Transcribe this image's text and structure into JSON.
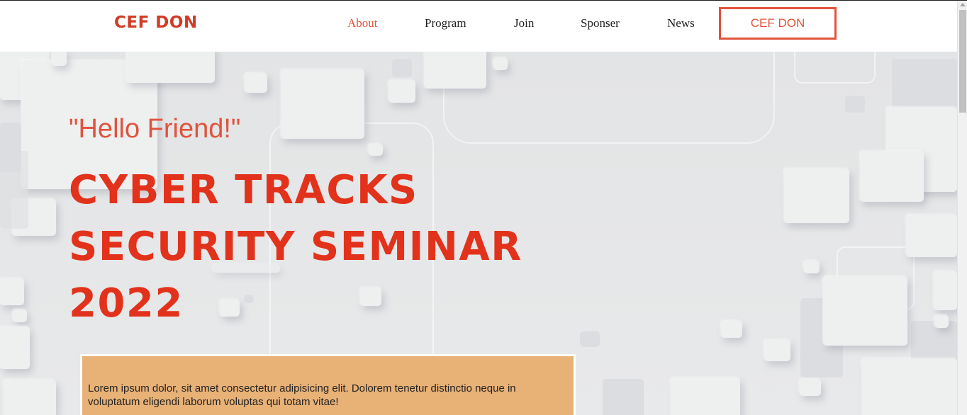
{
  "header": {
    "logo": "CEF DON",
    "nav": [
      {
        "label": "About"
      },
      {
        "label": "Program"
      },
      {
        "label": "Join"
      },
      {
        "label": "Sponser"
      },
      {
        "label": "News"
      }
    ],
    "cta_label": "CEF DON"
  },
  "hero": {
    "greeting": "\"Hello Friend!\"",
    "title_lines": [
      "CYBER TRACKS",
      "SECURITY SEMINAR",
      "2022"
    ],
    "card_text": "Lorem ipsum dolor, sit amet consectetur adipisicing elit. Dolorem tenetur distinctio neque in voluptatum eligendi laborum voluptas qui totam vitae!"
  },
  "colors": {
    "accent": "#e0533d",
    "title": "#e2321b",
    "card_bg": "#e8b176"
  }
}
